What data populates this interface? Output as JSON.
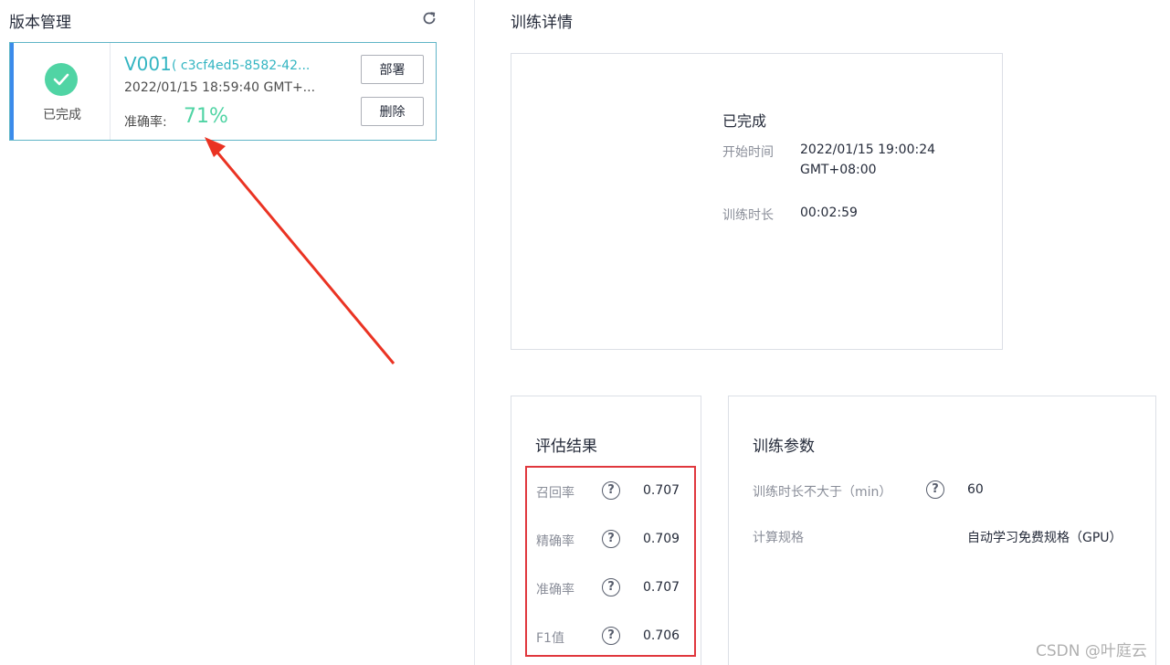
{
  "version_panel": {
    "title": "版本管理",
    "refresh_icon": "refresh-icon",
    "card": {
      "status_icon": "check-circle-icon",
      "status": "已完成",
      "version": "V001",
      "id": "( c3cf4ed5-8582-42...",
      "time": "2022/01/15 18:59:40 GMT+...",
      "accuracy_label": "准确率:",
      "accuracy_value": "71%",
      "deploy_label": "部署",
      "delete_label": "删除"
    }
  },
  "training_detail": {
    "title": "训练详情",
    "status": "已完成",
    "start_label": "开始时间",
    "start_value_line1": "2022/01/15 19:00:24",
    "start_value_line2": "GMT+08:00",
    "duration_label": "训练时长",
    "duration_value": "00:02:59"
  },
  "evaluation": {
    "title": "评估结果",
    "help_icon": "question-circle-icon",
    "metrics": [
      {
        "label": "召回率",
        "value": "0.707"
      },
      {
        "label": "精确率",
        "value": "0.709"
      },
      {
        "label": "准确率",
        "value": "0.707"
      },
      {
        "label": "F1值",
        "value": "0.706"
      }
    ]
  },
  "params": {
    "title": "训练参数",
    "max_duration_label": "训练时长不大于（min）",
    "max_duration_value": "60",
    "spec_label": "计算规格",
    "spec_value": "自动学习免费规格（GPU）"
  },
  "watermark": "CSDN @叶庭云",
  "colors": {
    "accent_blue": "#3b8beb",
    "success_green": "#50d4a4",
    "link_teal": "#33b5c2",
    "highlight_red": "#e0373d"
  }
}
